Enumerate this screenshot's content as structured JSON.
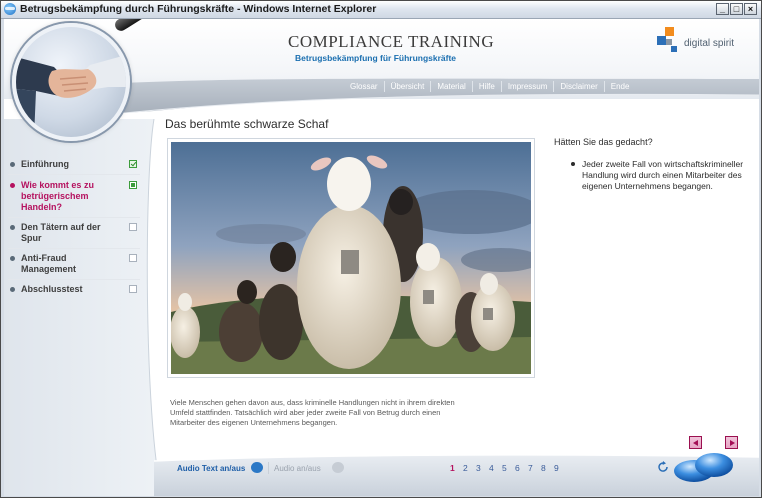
{
  "window": {
    "title": "Betrugsbekämpfung durch Führungskräfte - Windows Internet Explorer",
    "controls": [
      "_",
      "□",
      "×"
    ]
  },
  "header": {
    "title": "COMPLIANCE TRAINING",
    "subtitle": "Betrugsbekämpfung für Führungskräfte",
    "brand": "digital spirit",
    "brand_colors": [
      "#f28c1e",
      "#2c6fb7",
      "#8a96a3"
    ]
  },
  "nav": [
    "Glossar",
    "Übersicht",
    "Material",
    "Hilfe",
    "Impressum",
    "Disclaimer",
    "Ende"
  ],
  "sidebar": {
    "items": [
      {
        "label": "Einführung",
        "state": "done"
      },
      {
        "label": "Wie kommt es zu betrügerischem Handeln?",
        "state": "current"
      },
      {
        "label": "Den Tätern auf der Spur",
        "state": "open"
      },
      {
        "label": "Anti-Fraud Management",
        "state": "open"
      },
      {
        "label": "Abschlusstest",
        "state": "open"
      }
    ]
  },
  "content": {
    "title": "Das berühmte schwarze Schaf",
    "caption": "Viele Menschen gehen davon aus, dass kriminelle Handlungen nicht in ihrem direkten Umfeld stattfinden. Tatsächlich wird aber jeder zweite Fall von Betrug durch einen Mitarbeiter des eigenen Unternehmens begangen.",
    "question": "Hätten Sie das gedacht?",
    "bullet": "Jeder zweite Fall von wirtschaftskrimineller Handlung wird durch einen Mitarbeiter des eigenen Unternehmens begangen."
  },
  "footer": {
    "audio_text": "Audio Text an/aus",
    "audio": "Audio an/aus",
    "pages": [
      "1",
      "2",
      "3",
      "4",
      "5",
      "6",
      "7",
      "8",
      "9"
    ],
    "current_page": "1"
  },
  "icons": {
    "magnifier": "handshake-magnifier",
    "prev": "prev-arrow-icon",
    "next": "next-arrow-icon",
    "reload": "reload-icon",
    "speech": "speech-bubble-icon",
    "speaker": "speaker-icon"
  }
}
